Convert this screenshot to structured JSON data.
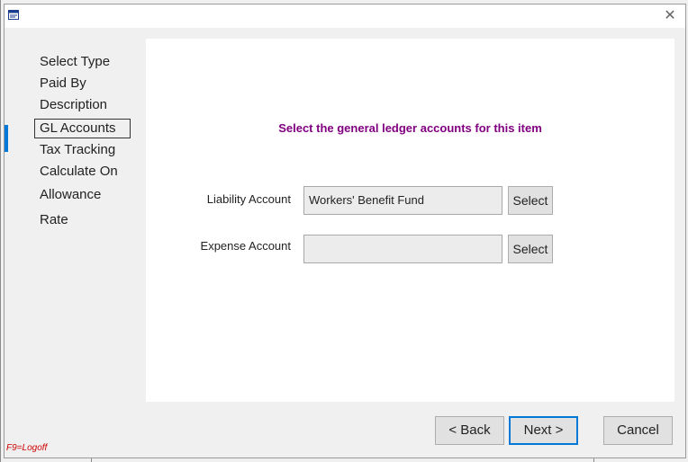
{
  "window": {
    "title": "",
    "close_glyph": "✕"
  },
  "steps": [
    {
      "label": "Select Type",
      "active": false
    },
    {
      "label": "Paid By",
      "active": false
    },
    {
      "label": "Description",
      "active": false
    },
    {
      "label": "GL Accounts",
      "active": true
    },
    {
      "label": "Tax Tracking",
      "active": false
    },
    {
      "label": "Calculate On",
      "active": false
    },
    {
      "label": "Allowance",
      "active": false
    },
    {
      "label": "Rate",
      "active": false
    }
  ],
  "main": {
    "heading": "Select the general ledger accounts for this item",
    "liability": {
      "label": "Liability Account",
      "value": "Workers' Benefit Fund",
      "button": "Select"
    },
    "expense": {
      "label": "Expense Account",
      "value": "",
      "button": "Select"
    }
  },
  "footer": {
    "back": "< Back",
    "next": "Next >",
    "cancel": "Cancel",
    "hotkey": "F9=Logoff"
  },
  "colors": {
    "heading": "#800080",
    "hotkey": "#cc0000",
    "accent": "#0078d7"
  }
}
